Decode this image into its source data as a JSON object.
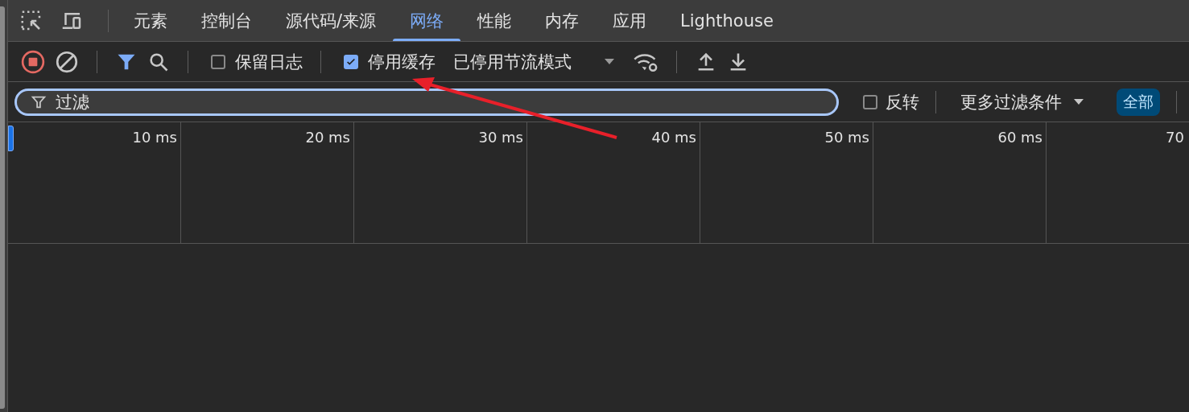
{
  "tabs": [
    {
      "label": "元素",
      "selected": false
    },
    {
      "label": "控制台",
      "selected": false
    },
    {
      "label": "源代码/来源",
      "selected": false
    },
    {
      "label": "网络",
      "selected": true
    },
    {
      "label": "性能",
      "selected": false
    },
    {
      "label": "内存",
      "selected": false
    },
    {
      "label": "应用",
      "selected": false
    },
    {
      "label": "Lighthouse",
      "selected": false
    }
  ],
  "toolbar": {
    "recording": true,
    "preserve_log": {
      "label": "保留日志",
      "checked": false
    },
    "disable_cache": {
      "label": "停用缓存",
      "checked": true
    },
    "throttling": "已停用节流模式"
  },
  "filter_bar": {
    "placeholder": "过滤",
    "invert": {
      "label": "反转",
      "checked": false
    },
    "more_filters": "更多过滤条件",
    "type_buttons": [
      {
        "label": "全部",
        "selected": true
      }
    ]
  },
  "timeline": {
    "ticks": [
      "10 ms",
      "20 ms",
      "30 ms",
      "40 ms",
      "50 ms",
      "60 ms",
      "70"
    ]
  }
}
